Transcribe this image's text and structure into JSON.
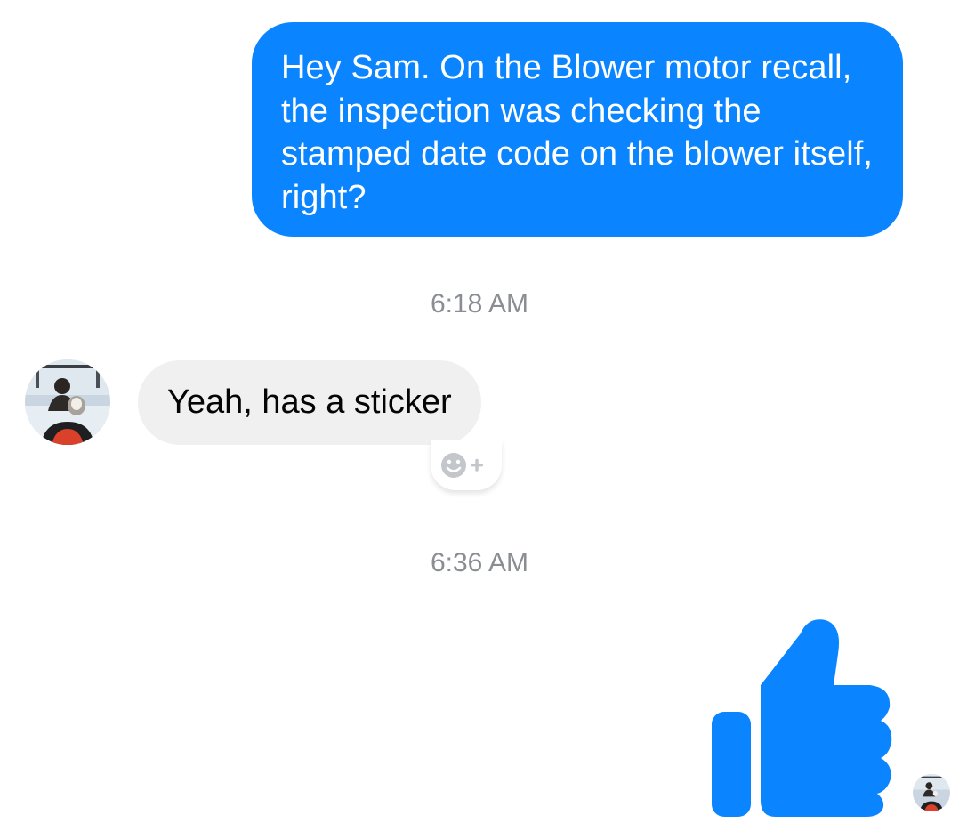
{
  "conversation": {
    "messages": [
      {
        "sender": "me",
        "text": "Hey Sam. On the Blower motor recall, the inspection was checking the stamped date code on the blower itself, right?"
      },
      {
        "sender": "Sam",
        "text": "Yeah, has a sticker"
      },
      {
        "sender": "me",
        "type": "like-sticker",
        "icon": "thumbs-up-icon"
      }
    ],
    "timestamps": [
      "6:18 AM",
      "6:36 AM"
    ]
  },
  "reaction": {
    "icon": "add-reaction-icon"
  },
  "colors": {
    "accent": "#0a84ff",
    "received_bubble": "#f0f0f0",
    "timestamp": "#8a8d91"
  }
}
